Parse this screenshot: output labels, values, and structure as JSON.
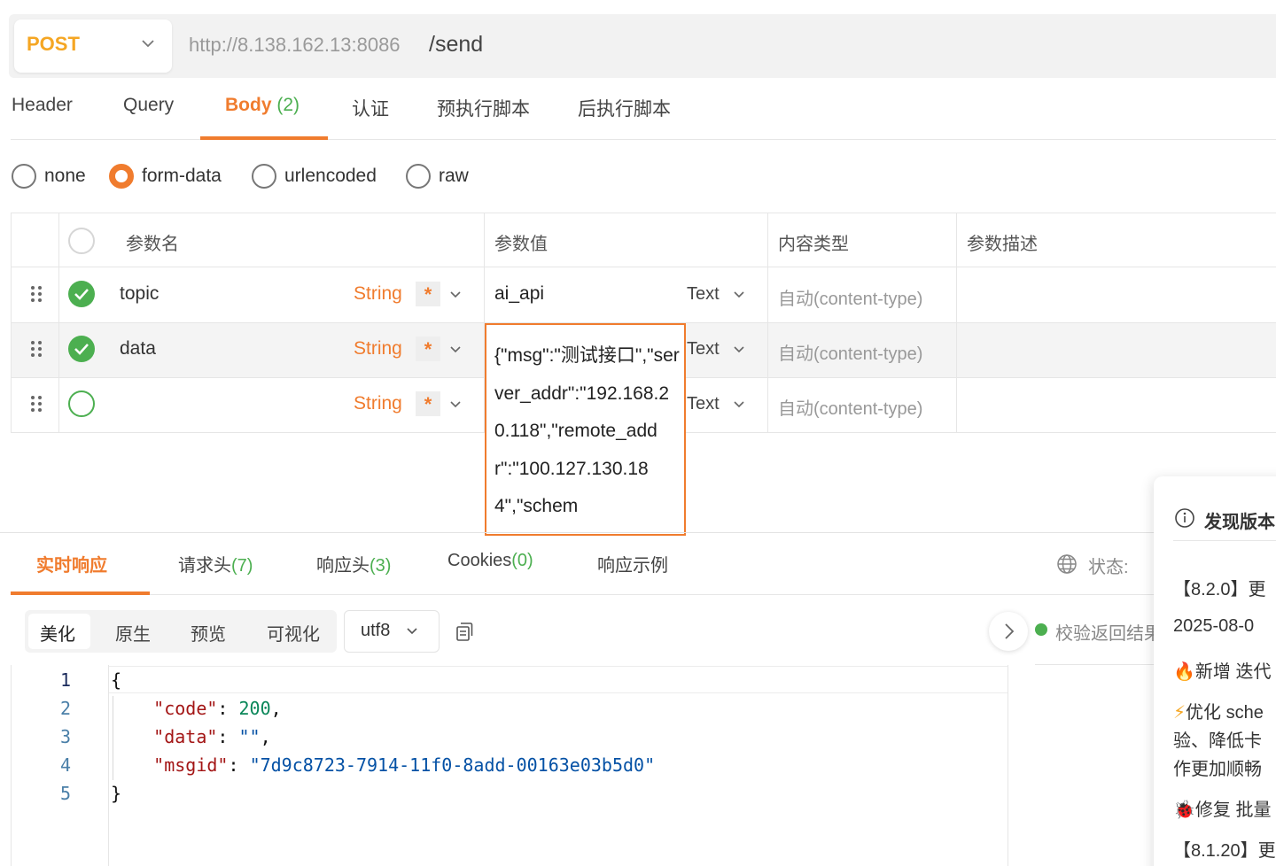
{
  "request": {
    "method": "POST",
    "url_host": "http://8.138.162.13:8086",
    "url_path": "/send"
  },
  "tabs": [
    {
      "label": "Header",
      "count": ""
    },
    {
      "label": "Query",
      "count": ""
    },
    {
      "label": "Body",
      "count": "(2)"
    },
    {
      "label": "认证",
      "count": ""
    },
    {
      "label": "预执行脚本",
      "count": ""
    },
    {
      "label": "后执行脚本",
      "count": ""
    }
  ],
  "active_tab": "Body",
  "body_modes": [
    "none",
    "form-data",
    "urlencoded",
    "raw"
  ],
  "selected_body_mode": "form-data",
  "params_table": {
    "headers": [
      "参数名",
      "参数值",
      "内容类型",
      "参数描述"
    ],
    "rows": [
      {
        "checked": true,
        "name": "topic",
        "type": "String",
        "required": "*",
        "value": "ai_api",
        "value_type": "Text",
        "content_type": "自动(content-type)",
        "description": ""
      },
      {
        "checked": true,
        "name": "data",
        "type": "String",
        "required": "*",
        "value": "{\"msg\":\"测试接口\",\"server_addr\":\"192.168.20.118\",\"remote_addr\":\"100.127.130.184\",\"schem",
        "value_type": "Text",
        "content_type": "自动(content-type)",
        "description": ""
      },
      {
        "checked": false,
        "name": "",
        "type": "String",
        "required": "*",
        "value": "",
        "value_type": "Text",
        "content_type": "自动(content-type)",
        "description": ""
      }
    ]
  },
  "response": {
    "tabs": [
      {
        "label": "实时响应",
        "count": ""
      },
      {
        "label": "请求头",
        "count": "(7)"
      },
      {
        "label": "响应头",
        "count": "(3)"
      },
      {
        "label": "Cookies",
        "count": "(0)"
      },
      {
        "label": "响应示例",
        "count": ""
      }
    ],
    "status_label": "状态:",
    "view_modes": [
      "美化",
      "原生",
      "预览",
      "可视化"
    ],
    "active_view_mode": "美化",
    "encoding": "utf8",
    "verify_label": "校验返回结果",
    "code_lines": [
      "1",
      "2",
      "3",
      "4",
      "5"
    ],
    "json": {
      "code_key": "\"code\"",
      "code_val": "200",
      "data_key": "\"data\"",
      "data_val": "\"\"",
      "msgid_key": "\"msgid\"",
      "msgid_val": "\"7d9c8723-7914-11f0-8add-00163e03b5d0\""
    }
  },
  "update_popup": {
    "title": "发现版本",
    "lines": [
      "【8.2.0】更",
      "2025-08-0",
      "新增 迭代",
      "优化 sche",
      "验、降低卡",
      "作更加顺畅",
      "修复 批量",
      "【8.1.20】更"
    ]
  },
  "colors": {
    "accent": "#f07c2e",
    "method": "#f5a623",
    "success": "#4caf50"
  }
}
